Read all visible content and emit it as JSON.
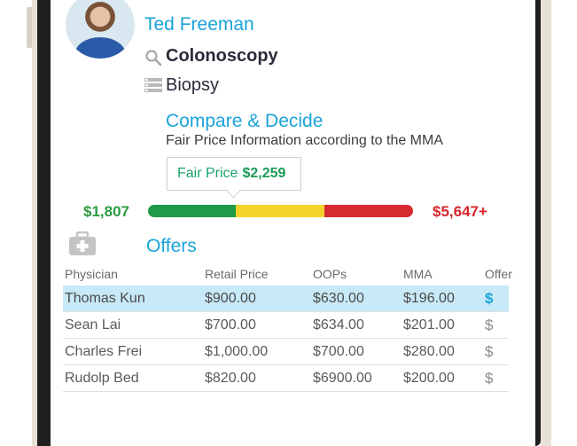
{
  "patient": {
    "name": "Ted Freeman"
  },
  "procedure": {
    "name": "Colonoscopy",
    "icon": "search-icon"
  },
  "category": {
    "name": "Biopsy",
    "icon": "list-icon"
  },
  "compare": {
    "title": "Compare & Decide",
    "subtitle": "Fair Price Information according to the MMA",
    "fair_price_label": "Fair Price",
    "fair_price_value": "$2,259",
    "low_price": "$1,807",
    "high_price": "$5,647+",
    "colors": {
      "green": "#1f9a47",
      "yellow": "#f2d22b",
      "red": "#d72a2f"
    }
  },
  "offers": {
    "title": "Offers",
    "icon": "medical-kit-icon",
    "columns": [
      "Physician",
      "Retail Price",
      "OOPs",
      "MMA",
      "Offer"
    ],
    "rows": [
      {
        "physician": "Thomas Kun",
        "retail": "$900.00",
        "oops": "$630.00",
        "mma": "$196.00",
        "offer": "$",
        "selected": true
      },
      {
        "physician": "Sean Lai",
        "retail": "$700.00",
        "oops": "$634.00",
        "mma": "$201.00",
        "offer": "$",
        "selected": false
      },
      {
        "physician": "Charles Frei",
        "retail": "$1,000.00",
        "oops": "$700.00",
        "mma": "$280.00",
        "offer": "$",
        "selected": false
      },
      {
        "physician": "Rudolp Bed",
        "retail": "$820.00",
        "oops": "$6900.00",
        "mma": "$200.00",
        "offer": "$",
        "selected": false
      }
    ]
  }
}
